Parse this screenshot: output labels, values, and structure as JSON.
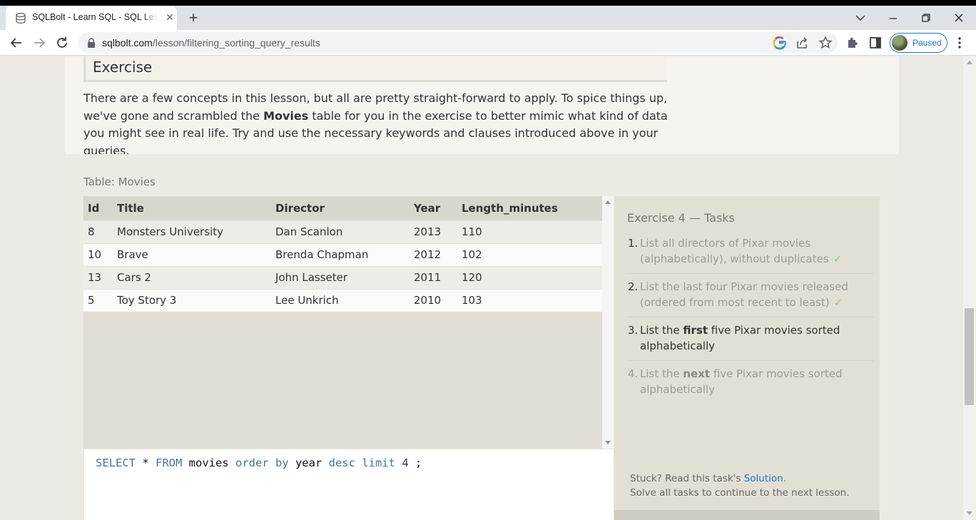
{
  "browser": {
    "tab_title": "SQLBolt - Learn SQL - SQL Lesson",
    "url_host": "sqlbolt.com",
    "url_path": "/lesson/filtering_sorting_query_results",
    "profile_status": "Paused",
    "accent_color": "#1a73e8"
  },
  "lesson": {
    "exercise_heading": "Exercise",
    "intro_part1": "There are a few concepts in this lesson, but all are pretty straight-forward to apply. To spice things up, we've gone and scrambled the ",
    "intro_bold": "Movies",
    "intro_part2": " table for you in the exercise to better mimic what kind of data you might see in real life. Try and use the necessary keywords and clauses introduced above in your queries."
  },
  "table": {
    "caption": "Table: Movies",
    "columns": [
      "Id",
      "Title",
      "Director",
      "Year",
      "Length_minutes"
    ],
    "rows": [
      [
        "8",
        "Monsters University",
        "Dan Scanlon",
        "2013",
        "110"
      ],
      [
        "10",
        "Brave",
        "Brenda Chapman",
        "2012",
        "102"
      ],
      [
        "13",
        "Cars 2",
        "John Lasseter",
        "2011",
        "120"
      ],
      [
        "5",
        "Toy Story 3",
        "Lee Unkrich",
        "2010",
        "103"
      ]
    ]
  },
  "editor": {
    "tokens": [
      {
        "t": "SELECT",
        "k": "kw"
      },
      {
        "t": " * ",
        "k": ""
      },
      {
        "t": "FROM",
        "k": "kw"
      },
      {
        "t": " movies ",
        "k": ""
      },
      {
        "t": "order by",
        "k": "kw"
      },
      {
        "t": " year ",
        "k": ""
      },
      {
        "t": "desc limit",
        "k": "kw"
      },
      {
        "t": " ",
        "k": ""
      },
      {
        "t": "4",
        "k": "num"
      },
      {
        "t": " ;",
        "k": ""
      }
    ]
  },
  "tasks": {
    "title": "Exercise 4 — Tasks",
    "items": [
      {
        "num": "1.",
        "pre": "List all directors of Pixar movies (alphabetically), without duplicates",
        "bold": "",
        "post": "",
        "state": "done"
      },
      {
        "num": "2.",
        "pre": "List the last four Pixar movies released (ordered from most recent to least)",
        "bold": "",
        "post": "",
        "state": "done"
      },
      {
        "num": "3.",
        "pre": "List the ",
        "bold": "first",
        "post": " five Pixar movies sorted alphabetically",
        "state": "current"
      },
      {
        "num": "4.",
        "pre": "List the ",
        "bold": "next",
        "post": " five Pixar movies sorted alphabetically",
        "state": "upcoming"
      }
    ],
    "check_glyph": "✓",
    "stuck_text": "Stuck? Read this task's ",
    "solution_link": "Solution",
    "stuck_end": ".",
    "continue_text": "Solve all tasks to continue to the next lesson."
  }
}
